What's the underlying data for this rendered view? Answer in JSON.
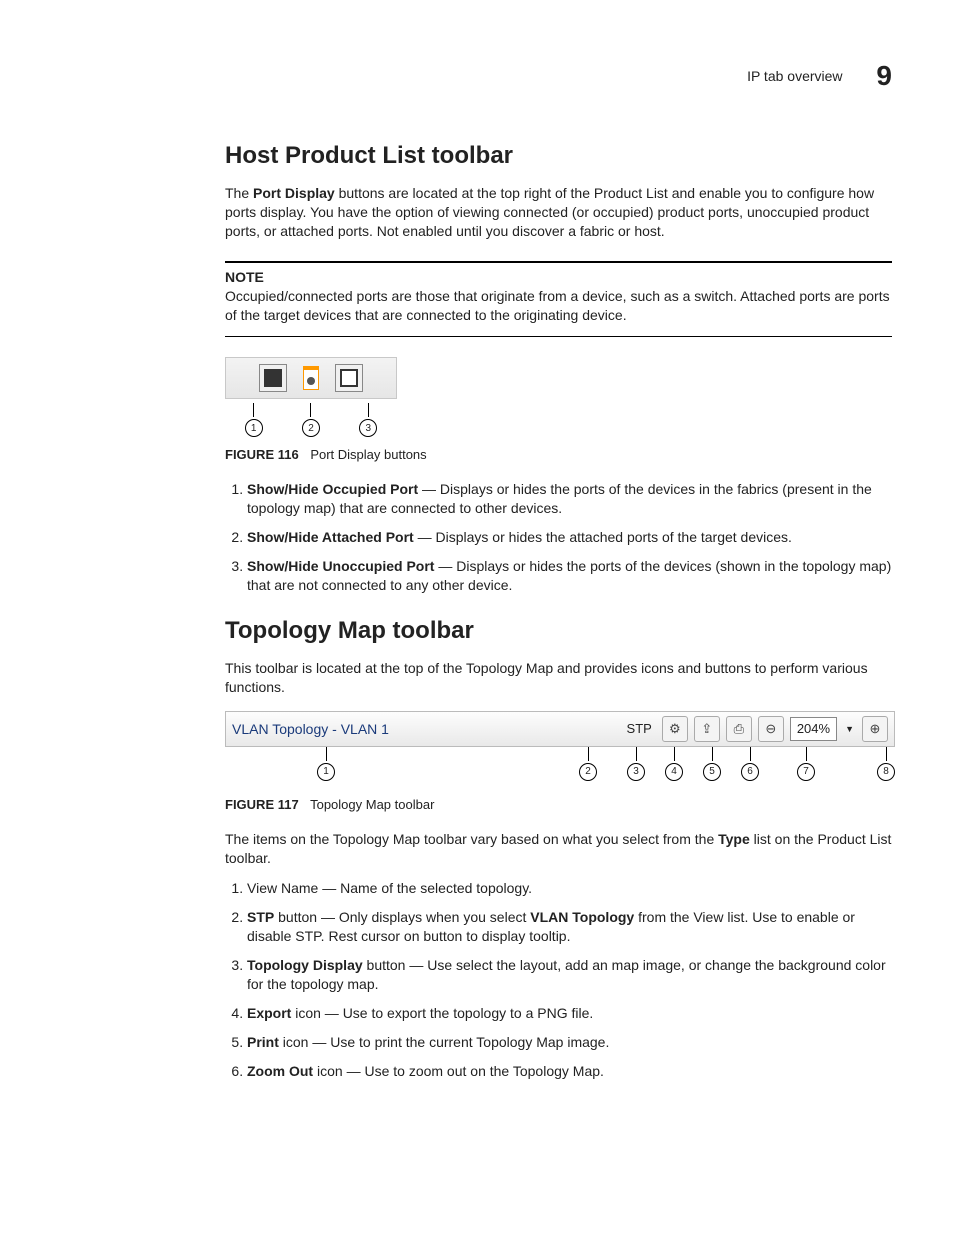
{
  "header": {
    "section": "IP tab overview",
    "chapter": "9"
  },
  "s1": {
    "title": "Host Product List toolbar",
    "intro_pre": "The ",
    "intro_bold": "Port Display",
    "intro_post": " buttons are located at the top right of the Product List and enable you to configure how ports display. You have the option of viewing connected (or occupied) product ports, unoccupied product ports, or attached ports. Not enabled until you discover a fabric or host.",
    "note_label": "NOTE",
    "note_text": "Occupied/connected ports are those that originate from a device, such as a switch. Attached ports are ports of the target devices that are connected to the originating device.",
    "fig_num": "FIGURE 116",
    "fig_title": "Port Display buttons",
    "items": [
      {
        "bold": "Show/Hide Occupied Port",
        "text": " — Displays or hides the ports of the devices in the fabrics (present in the topology map) that are connected to other devices."
      },
      {
        "bold": "Show/Hide Attached Port",
        "text": " — Displays or hides the attached ports of the target devices."
      },
      {
        "bold": "Show/Hide Unoccupied Port",
        "text": " — Displays or hides the ports of the devices (shown in the topology map) that are not connected to any other device."
      }
    ],
    "callouts": [
      "1",
      "2",
      "3"
    ]
  },
  "s2": {
    "title": "Topology Map toolbar",
    "intro": "This toolbar is located at the top of the Topology Map and provides icons and buttons to perform various functions.",
    "toolbar": {
      "view_name": "VLAN Topology - VLAN 1",
      "stp": "STP",
      "zoom": "204%"
    },
    "fig_num": "FIGURE 117",
    "fig_title": "Topology Map toolbar",
    "after_pre": "The items on the Topology Map toolbar vary based on what you select from the ",
    "after_bold": "Type",
    "after_post": " list on the Product List toolbar.",
    "items": [
      {
        "pre": "View Name — Name of the selected topology."
      },
      {
        "b1": "STP",
        "mid1": " button — Only displays when you select ",
        "b2": "VLAN Topology",
        "post": " from the View list. Use to enable or disable STP. Rest cursor on button to display tooltip."
      },
      {
        "b1": "Topology Display",
        "post": " button — Use select the layout, add an map image, or change the background color for the topology map."
      },
      {
        "b1": "Export",
        "post": " icon — Use to export the topology to a PNG file."
      },
      {
        "b1": "Print",
        "post": " icon — Use to print the current Topology Map image."
      },
      {
        "b1": "Zoom Out",
        "post": " icon — Use to zoom out on the Topology Map."
      }
    ],
    "callouts": [
      "1",
      "2",
      "3",
      "4",
      "5",
      "6",
      "7",
      "8"
    ]
  }
}
